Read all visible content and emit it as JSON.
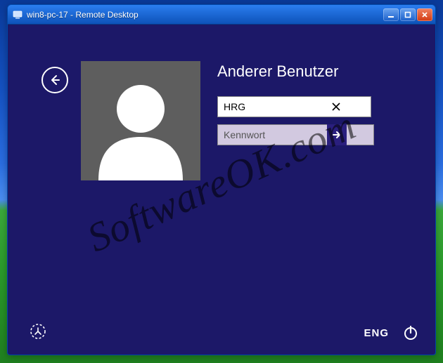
{
  "window": {
    "title": "win8-pc-17 - Remote Desktop"
  },
  "login": {
    "user_title": "Anderer Benutzer",
    "username": "HRG",
    "password_placeholder": "Kennwort",
    "language": "ENG"
  },
  "watermark": "SoftwareOK.com"
}
